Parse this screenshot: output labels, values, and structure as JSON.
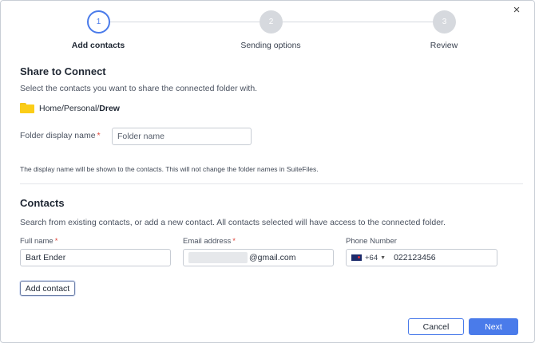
{
  "dialog": {
    "close_icon": "×"
  },
  "stepper": {
    "steps": [
      {
        "number": "1",
        "label": "Add contacts",
        "state": "active"
      },
      {
        "number": "2",
        "label": "Sending options",
        "state": "inactive"
      },
      {
        "number": "3",
        "label": "Review",
        "state": "inactive"
      }
    ]
  },
  "share": {
    "title": "Share to Connect",
    "description": "Select the contacts you want to share the connected folder with.",
    "folder_path_prefix": "Home/Personal/",
    "folder_path_last": "Drew",
    "folder_icon": "folder-icon",
    "display_name_label": "Folder display name",
    "required_mark": "*",
    "display_name_placeholder": "Folder name",
    "hint": "The display name will be shown to the contacts. This will not change the folder names in SuiteFiles."
  },
  "contacts": {
    "title": "Contacts",
    "description": "Search from existing contacts, or add a new contact. All contacts selected will have access to the connected folder.",
    "full_name_label": "Full name",
    "full_name_value": "Bart Ender",
    "email_label": "Email address",
    "email_value_suffix": "@gmail.com",
    "phone_label": "Phone Number",
    "phone_country_code": "+64",
    "phone_value": "022123456",
    "add_contact_label": "Add contact"
  },
  "footer": {
    "cancel_label": "Cancel",
    "next_label": "Next"
  },
  "colors": {
    "accent": "#4a7bea",
    "required": "#e0453a",
    "folder": "#fbcd18"
  }
}
